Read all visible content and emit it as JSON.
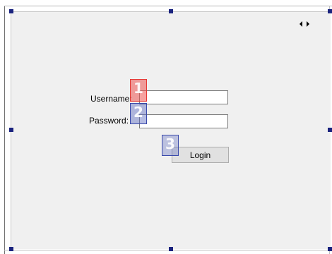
{
  "form": {
    "username_label": "Username:",
    "password_label": "Password:",
    "username_value": "",
    "password_value": "",
    "login_label": "Login"
  },
  "designer": {
    "scroll_arrows": [
      "arrow-left-icon",
      "arrow-right-icon"
    ]
  },
  "markers": {
    "m1": "1",
    "m2": "2",
    "m3": "3"
  },
  "colors": {
    "surface": "#f0f0f0",
    "handle": "#1a237e",
    "marker1": "#e53935",
    "marker2": "#3949ab",
    "marker3": "#3949ab",
    "button": "#e1e1e1"
  }
}
